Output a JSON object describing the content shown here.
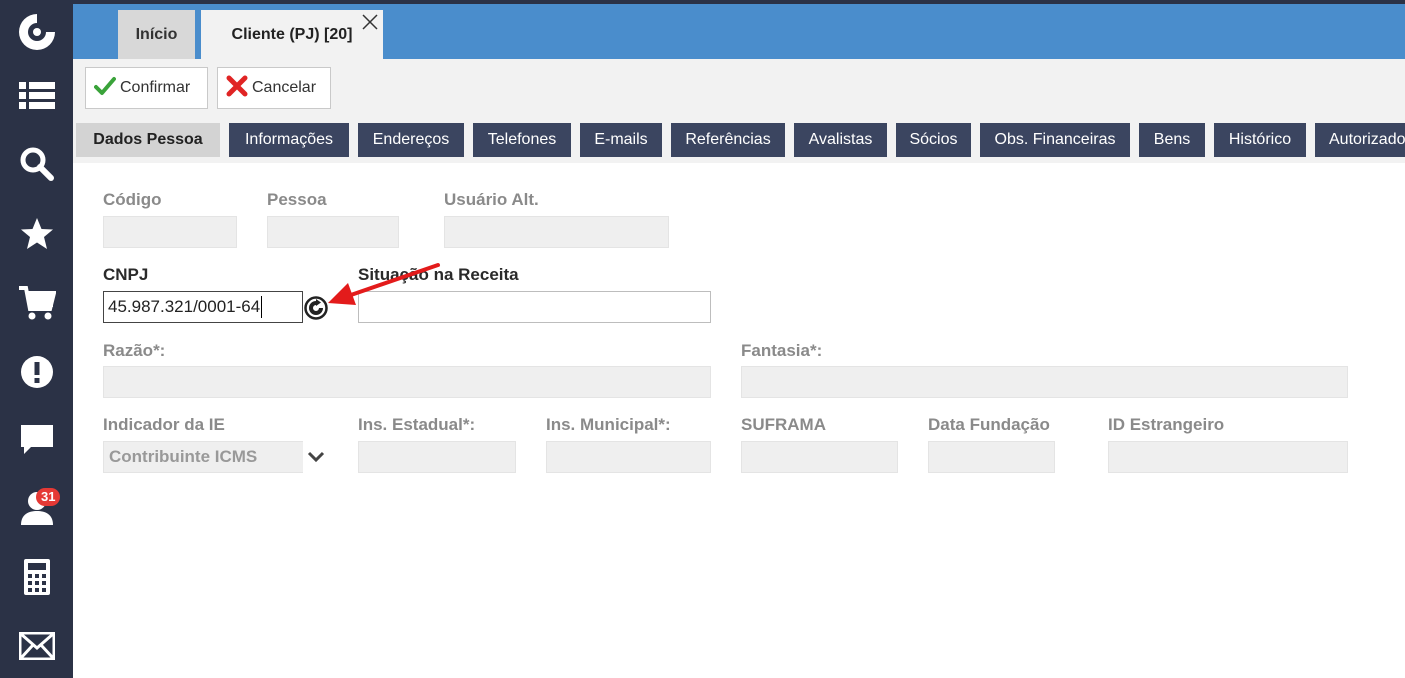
{
  "sidebar": {
    "icons": [
      "logo-icon",
      "list-icon",
      "search-icon",
      "star-icon",
      "cart-icon",
      "alert-icon",
      "chat-icon",
      "user-icon",
      "calculator-icon",
      "mail-icon"
    ],
    "user_badge": "31"
  },
  "header": {
    "tabs": [
      {
        "label": "Início"
      },
      {
        "label": "Cliente (PJ) [20]"
      }
    ]
  },
  "toolbar": {
    "confirm_label": "Confirmar",
    "cancel_label": "Cancelar"
  },
  "section_tabs": [
    {
      "label": "Dados Pessoa",
      "active": true
    },
    {
      "label": "Informações"
    },
    {
      "label": "Endereços"
    },
    {
      "label": "Telefones"
    },
    {
      "label": "E-mails"
    },
    {
      "label": "Referências"
    },
    {
      "label": "Avalistas"
    },
    {
      "label": "Sócios"
    },
    {
      "label": "Obs. Financeiras"
    },
    {
      "label": "Bens"
    },
    {
      "label": "Histórico"
    },
    {
      "label": "Autorizado"
    }
  ],
  "form": {
    "codigo": {
      "label": "Código",
      "value": ""
    },
    "pessoa": {
      "label": "Pessoa",
      "value": ""
    },
    "usuario_alt": {
      "label": "Usuário Alt.",
      "value": ""
    },
    "cnpj": {
      "label": "CNPJ",
      "value": "45.987.321/0001-64"
    },
    "situacao": {
      "label": "Situação na Receita",
      "value": ""
    },
    "razao": {
      "label": "Razão*:",
      "value": ""
    },
    "fantasia": {
      "label": "Fantasia*:",
      "value": ""
    },
    "indicador_ie": {
      "label": "Indicador da IE",
      "value": "Contribuinte ICMS"
    },
    "ins_estadual": {
      "label": "Ins. Estadual*:",
      "value": ""
    },
    "ins_municipal": {
      "label": "Ins. Municipal*:",
      "value": ""
    },
    "suframa": {
      "label": "SUFRAMA",
      "value": ""
    },
    "data_fundacao": {
      "label": "Data Fundação",
      "value": ""
    },
    "id_estrangeiro": {
      "label": "ID Estrangeiro",
      "value": ""
    }
  },
  "colors": {
    "sidebar": "#2b3246",
    "header": "#4a8dcc",
    "section_tab": "#3b4560",
    "annotation_arrow": "#e31b1b"
  }
}
